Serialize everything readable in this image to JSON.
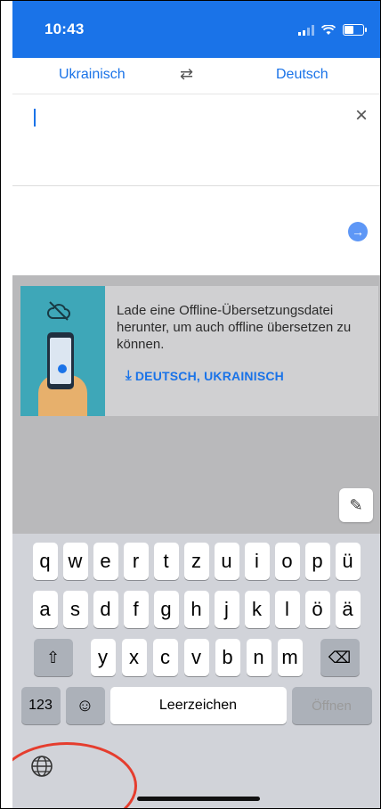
{
  "status_bar": {
    "time": "10:43"
  },
  "language_bar": {
    "source": "Ukrainisch",
    "target": "Deutsch",
    "swap_icon": "⇄"
  },
  "input": {
    "clear_icon": "×"
  },
  "output": {
    "go_icon": "→"
  },
  "offline_card": {
    "message": "Lade eine Offline-Übersetzungsdatei herunter, um auch offline übersetzen zu können.",
    "download_label": "DEUTSCH, UKRAINISCH",
    "download_icon": "⤓"
  },
  "handwriting": {
    "icon": "✎"
  },
  "keyboard": {
    "row1": [
      "q",
      "w",
      "e",
      "r",
      "t",
      "z",
      "u",
      "i",
      "o",
      "p",
      "ü"
    ],
    "row2": [
      "a",
      "s",
      "d",
      "f",
      "g",
      "h",
      "j",
      "k",
      "l",
      "ö",
      "ä"
    ],
    "row3": [
      "y",
      "x",
      "c",
      "v",
      "b",
      "n",
      "m"
    ],
    "shift_icon": "⇧",
    "backspace_icon": "⌫",
    "numbers_label": "123",
    "emoji_icon": "☺",
    "space_label": "Leerzeichen",
    "return_label": "Öffnen",
    "globe_icon": "🌐"
  },
  "colors": {
    "accent": "#1a73e8",
    "annotation": "#e53d2e"
  }
}
